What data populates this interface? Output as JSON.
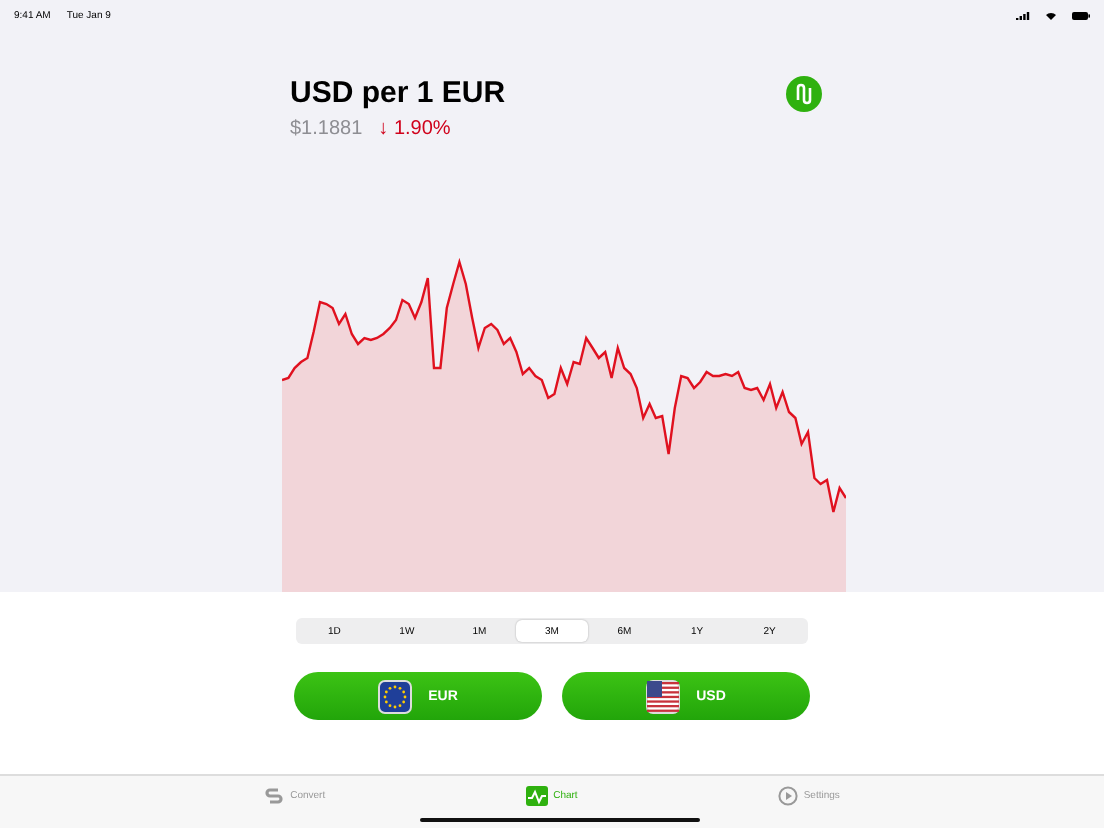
{
  "status_bar": {
    "time": "9:41 AM",
    "date": "Tue Jan 9"
  },
  "header": {
    "title": "USD per 1 EUR",
    "rate": "$1.1881",
    "change_arrow": "↓",
    "change": "1.90%"
  },
  "ranges": [
    {
      "label": "1D",
      "selected": false
    },
    {
      "label": "1W",
      "selected": false
    },
    {
      "label": "1M",
      "selected": false
    },
    {
      "label": "3M",
      "selected": true
    },
    {
      "label": "6M",
      "selected": false
    },
    {
      "label": "1Y",
      "selected": false
    },
    {
      "label": "2Y",
      "selected": false
    }
  ],
  "currencies": [
    {
      "code": "EUR",
      "kind": "eu"
    },
    {
      "code": "USD",
      "kind": "us"
    }
  ],
  "tab_bar": [
    {
      "label": "Convert",
      "kind": "convert",
      "selected": false
    },
    {
      "label": "Chart",
      "kind": "chart",
      "selected": true
    },
    {
      "label": "Settings",
      "kind": "settings",
      "selected": false
    }
  ]
}
